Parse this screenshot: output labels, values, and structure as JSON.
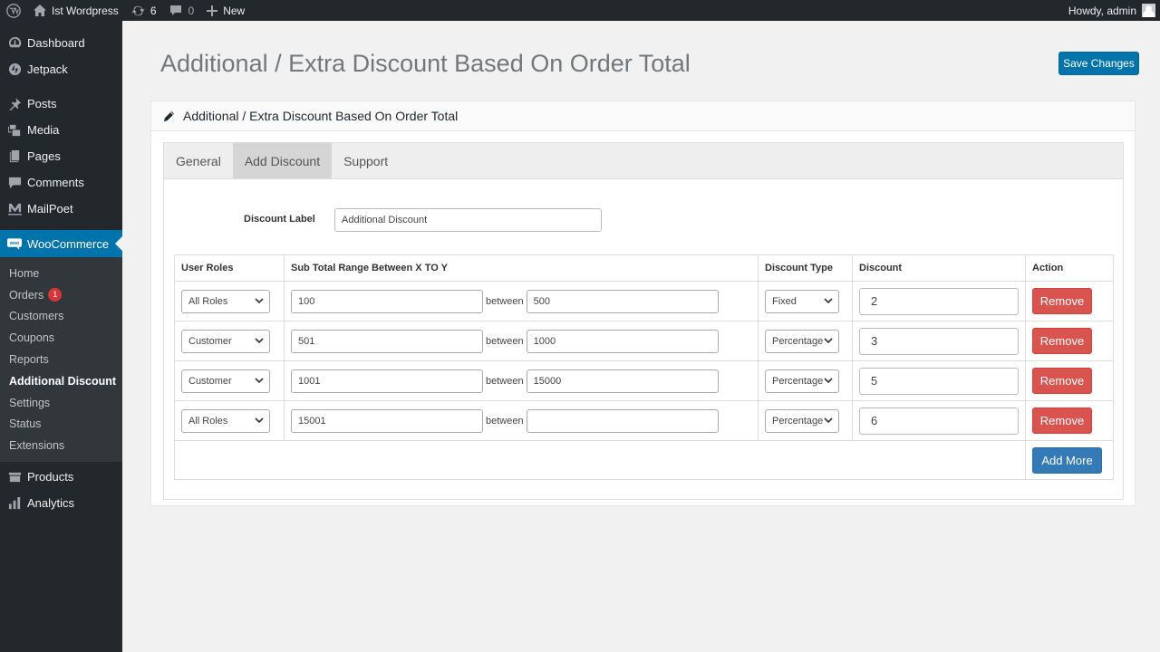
{
  "admin_bar": {
    "site_name": "Ist Wordpress",
    "updates_count": "6",
    "comments_count": "0",
    "new_label": "New",
    "greeting": "Howdy, admin"
  },
  "sidebar": {
    "items_top": [
      {
        "label": "Dashboard",
        "icon": "dashboard-icon"
      },
      {
        "label": "Jetpack",
        "icon": "jetpack-icon"
      }
    ],
    "items_mid": [
      {
        "label": "Posts",
        "icon": "pin-icon"
      },
      {
        "label": "Media",
        "icon": "media-icon"
      },
      {
        "label": "Pages",
        "icon": "pages-icon"
      },
      {
        "label": "Comments",
        "icon": "comment-icon"
      },
      {
        "label": "MailPoet",
        "icon": "mailpoet-icon"
      }
    ],
    "woocommerce": {
      "label": "WooCommerce",
      "icon": "woo-icon"
    },
    "submenu": [
      {
        "label": "Home"
      },
      {
        "label": "Orders",
        "badge": "1"
      },
      {
        "label": "Customers"
      },
      {
        "label": "Coupons"
      },
      {
        "label": "Reports"
      },
      {
        "label": "Additional Discount",
        "active": true
      },
      {
        "label": "Settings"
      },
      {
        "label": "Status"
      },
      {
        "label": "Extensions"
      }
    ],
    "items_bottom": [
      {
        "label": "Products",
        "icon": "products-icon"
      },
      {
        "label": "Analytics",
        "icon": "analytics-icon"
      }
    ]
  },
  "page": {
    "title": "Additional / Extra Discount Based On Order Total",
    "save_label": "Save Changes",
    "panel_title": "Additional / Extra Discount Based On Order Total"
  },
  "tabs": [
    {
      "label": "General",
      "active": false
    },
    {
      "label": "Add Discount",
      "active": true
    },
    {
      "label": "Support",
      "active": false
    }
  ],
  "form": {
    "discount_label_text": "Discount Label",
    "discount_label_value": "Additional Discount"
  },
  "table": {
    "headers": [
      "User Roles",
      "Sub Total Range Between X TO Y",
      "Discount Type",
      "Discount",
      "Action"
    ],
    "between_text": "between",
    "remove_label": "Remove",
    "add_more_label": "Add More",
    "rows": [
      {
        "role": "All Roles",
        "from": "100",
        "to": "500",
        "type": "Fixed",
        "discount": "2"
      },
      {
        "role": "Customer",
        "from": "501",
        "to": "1000",
        "type": "Percentage",
        "discount": "3"
      },
      {
        "role": "Customer",
        "from": "1001",
        "to": "15000",
        "type": "Percentage",
        "discount": "5"
      },
      {
        "role": "All Roles",
        "from": "15001",
        "to": "",
        "type": "Percentage",
        "discount": "6"
      }
    ]
  },
  "colors": {
    "admin_dark": "#23282d",
    "wp_blue": "#0073aa",
    "remove_red": "#d9534f",
    "add_blue": "#337ab7",
    "badge_red": "#d63638"
  }
}
